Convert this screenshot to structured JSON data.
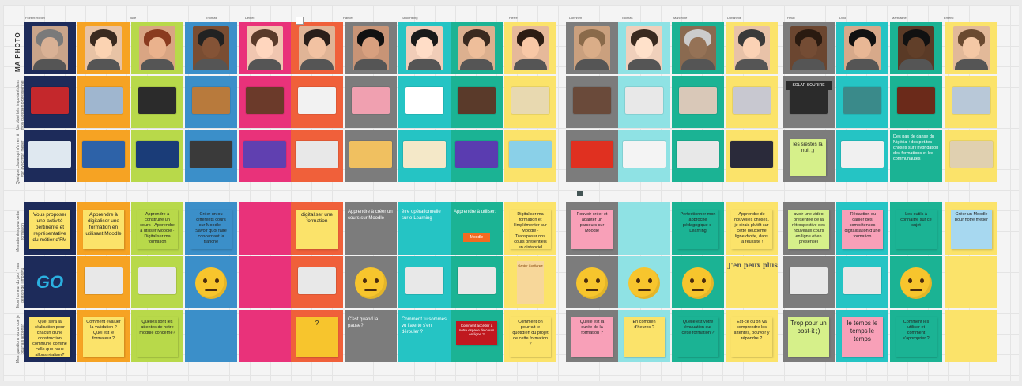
{
  "board": {
    "row_labels_top": [
      "MA PHOTO",
      "Un objet très important dans mon quotidien professionnel",
      "Quelque chose qui n'a rien à voir avec mon métier"
    ],
    "row_labels_bottom": [
      "Mes attentes pour cette formation",
      "Mon humeur du jour / ma gestion de l'imprévu",
      "Mes questions ou ce que je pourrais apporter"
    ],
    "top_column_names": [
      "Florent Riedel",
      "",
      "Julie",
      "",
      "Thomas",
      "",
      "Delhei",
      "",
      "Hancel",
      "",
      "Saloi Heing",
      "",
      "Pierre",
      "",
      "Dorinhen",
      "",
      "Thomas",
      "",
      "Marceline",
      "",
      "Dorinhelle",
      "",
      "Heuri",
      "",
      "Dino",
      "",
      "Nora",
      "Marthaline",
      "",
      "Emeric"
    ],
    "columns": [
      {
        "name": "Florent Riedel",
        "color": "#1d2b5a"
      },
      {
        "name": "",
        "color": "#f6a323"
      },
      {
        "name": "Julie",
        "color": "#b8d94a"
      },
      {
        "name": "Thomas",
        "color": "#3b8fc9"
      },
      {
        "name": "Delhei",
        "color": "#e9327a"
      },
      {
        "name": "",
        "color": "#f0603a"
      },
      {
        "name": "Hancel",
        "color": "#7c7c7c"
      },
      {
        "name": "Saloi Heing",
        "color": "#25c4c4"
      },
      {
        "name": "",
        "color": "#1bb394"
      },
      {
        "name": "Pierre",
        "color": "#fbe36a"
      },
      {
        "name": "Dorinhen",
        "color": "#7c7c7c"
      },
      {
        "name": "Thomas",
        "color": "#8fe2e4"
      },
      {
        "name": "Marceline",
        "color": "#1bb394"
      },
      {
        "name": "Dorinhelle",
        "color": "#fbe36a"
      },
      {
        "name": "Heuri",
        "color": "#7c7c7c"
      },
      {
        "name": "Dino",
        "color": "#25c4c4"
      },
      {
        "name": "Marthaline",
        "color": "#1bb394"
      },
      {
        "name": "Emeric",
        "color": "#fbe36a"
      }
    ],
    "row3_text": {
      "gray_a": "les siestes la nuit ;)",
      "teal_c": "Des pas de danse du Nigéria +des pet.tes choses sur l'hybridation des formations et les communautés",
      "sign": "SOLAR SOURIRE"
    },
    "row4_text": {
      "c0": "Vous proposer une activité pertinente et représentative du métier d'FM",
      "c1": "Apprendre à digitaliser une formation en utilisant Moodle",
      "c2": "Apprendre à construire un cours · Apprendre à utiliser Moodle · Digitaliser ma formation",
      "c3": "Créer un ou différents cours sur Moodle · Savoir quoi faire concernant la tranche",
      "c5": "digitaliser une formation",
      "c6": "Apprendre à créer un cours sur Moodle",
      "c7": "être opérationnelle sur e-Learning",
      "c8": "Apprendre à utiliser:",
      "c8b": "Moodle",
      "c9": "Digitaliser ma formation et l'implémenter sur Moodle · Transposer nos cours présentiels en distanciel",
      "c10": "Pouvoir créer et adapter un parcours sur Moodle",
      "c12": "Perfectionner mon approche pédagogique e-Learning",
      "c13": "Apprendre de nouvelles choses, je dirais plutôt sur cette deuxième ligne droite, dans la réussite !",
      "c14": "avoir une vidéo présentée de la rétrospective des nouveaux cours en ligne et en présentiel",
      "c15": "-Rédaction du cahier des compétences digitalisation d'une formation",
      "c16": "Les outils à connaître sur ce sujet",
      "c17": "Créer un Moodle pour notre métier"
    },
    "row5_text": {
      "c0": "GO",
      "c9": "Garder Confiance",
      "c13": "J'en peux plus"
    },
    "row6_text": {
      "c0": "Quel sera la réalisation pour chacun d'une construction commune comme celle que nous allons réaliser?",
      "c1": "Comment évaluer la validation ? Quel est le formateur ?",
      "c2": "Quelles sont les attentes de notre module concerné?",
      "c5": "?",
      "c6": "C'est quand la pause?",
      "c7": "Comment tu sommes vu l'alerte s'en dérouler ?",
      "c8": "Comment accéder à notre espace de cours en ligne ?",
      "c9": "Comment on pourrait le quotidien du projet de cette formation ?",
      "c10": "Quelle est la durée de la formation ?",
      "c11": "En combien d'heures ?",
      "c12": "Quelle est votre évaluation sur cette formation ?",
      "c13": "Est-ce qu'on va comprendre les attentes, pouvoir y répondre ?",
      "c14": "Trop pour un post-it ;)",
      "c15": "le temps le temps le temps",
      "c16": "Comment les utiliser et comment s'approprier ?"
    }
  }
}
